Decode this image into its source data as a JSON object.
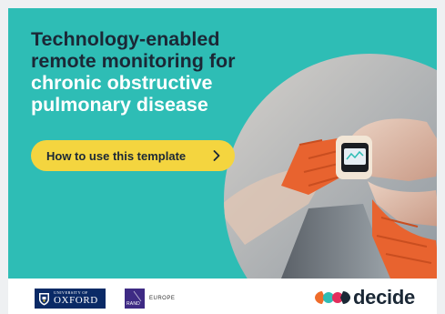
{
  "hero": {
    "title_line_1": "Technology-enabled",
    "title_line_2": "remote monitoring for",
    "title_line_3": "chronic obstructive",
    "title_line_4": "pulmonary disease",
    "cta_label": "How to use this template",
    "cta_icon": "chevron-right-icon",
    "photo_subject": "smartwatch-on-wrist-photo"
  },
  "footer": {
    "oxford_small": "UNIVERSITY OF",
    "oxford_large": "OXFORD",
    "rand_mark": "RAND",
    "rand_region": "EUROPE",
    "decide_word": "decide"
  },
  "colors": {
    "teal": "#2ebdb5",
    "navy": "#1b2836",
    "yellow": "#f4d53f",
    "white": "#ffffff",
    "orange": "#e8632f",
    "oxford_blue": "#0a2a66",
    "rand_purple": "#3e2a84"
  }
}
